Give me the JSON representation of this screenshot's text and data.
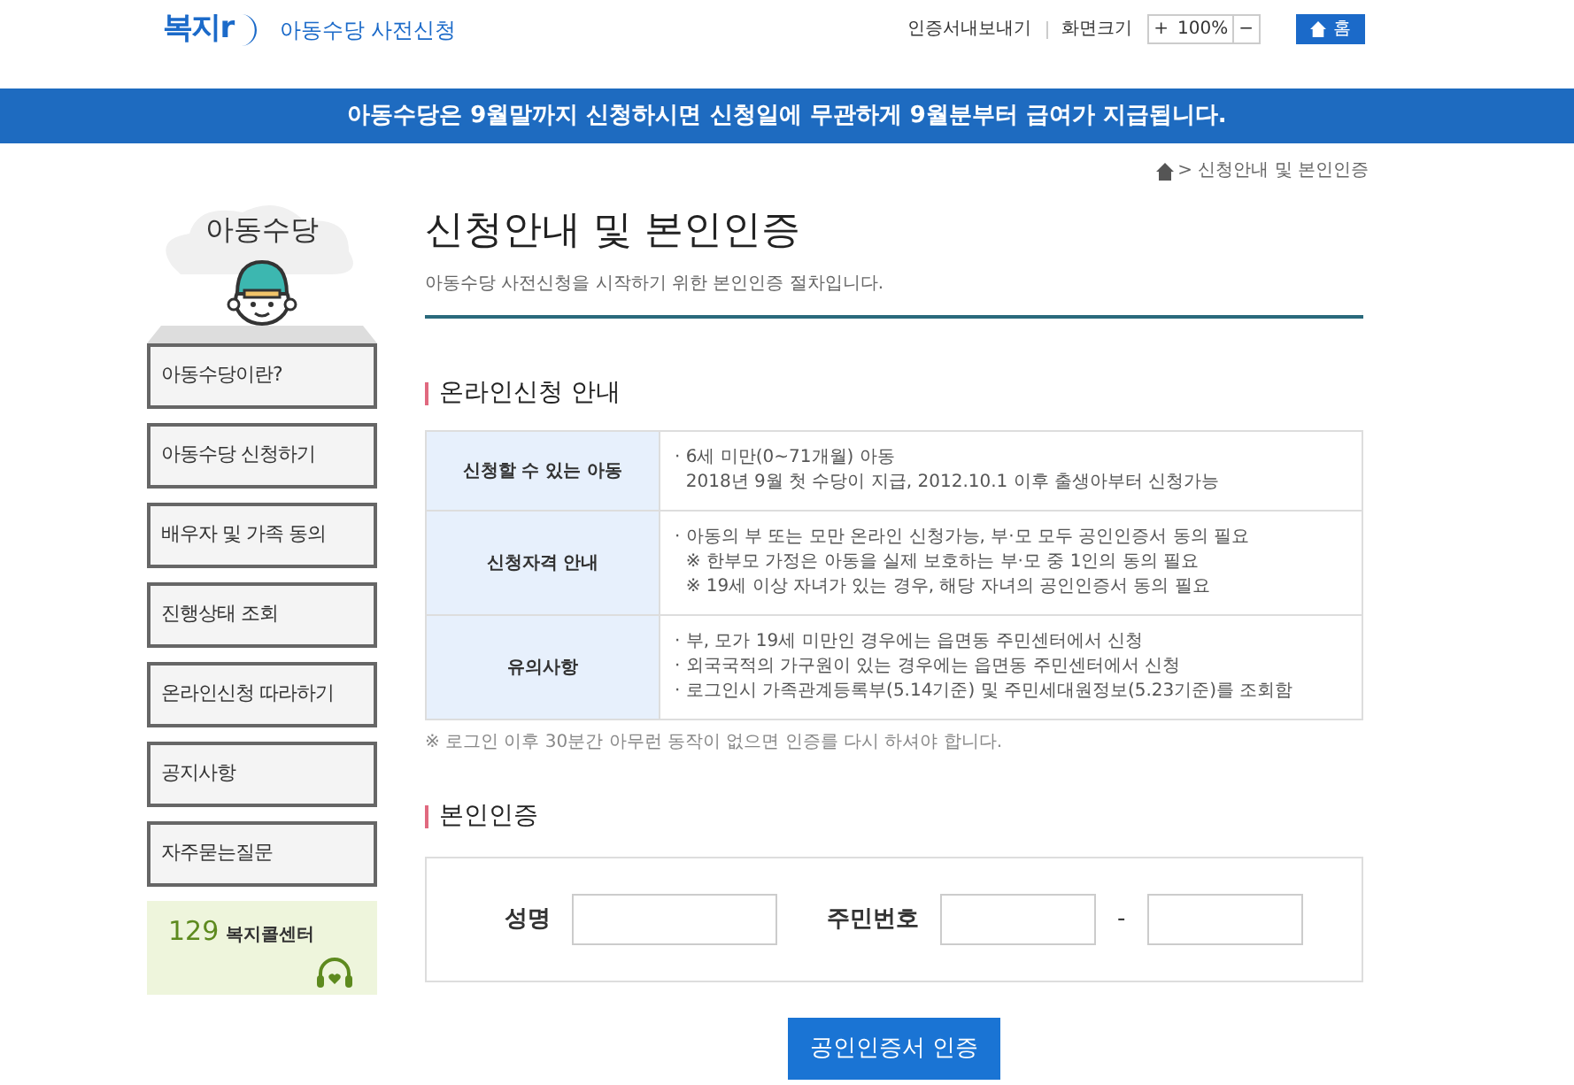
{
  "header": {
    "logo": "복지r",
    "site_title": "아동수당 사전신청",
    "export_link": "인증서내보내기",
    "zoom_label": "화면크기",
    "zoom_in": "+",
    "zoom_value": "100%",
    "zoom_out": "−",
    "home_button": "홈"
  },
  "banner": "아동수당은 9월말까지 신청하시면 신청일에 무관하게 9월분부터 급여가 지급됩니다.",
  "breadcrumb": "> 신청안내 및 본인인증",
  "sidebar": {
    "title": "아동수당",
    "items": [
      {
        "label": "아동수당이란?",
        "selected": false
      },
      {
        "label": "아동수당 신청하기",
        "selected": false
      },
      {
        "label": "배우자 및 가족 동의",
        "selected": false
      },
      {
        "label": "진행상태 조회",
        "selected": false
      },
      {
        "label": "온라인신청 따라하기",
        "selected": false
      },
      {
        "label": "공지사항",
        "selected": false
      },
      {
        "label": "자주묻는질문",
        "selected": false
      }
    ],
    "call_center": {
      "number": "129",
      "label": "복지콜센터"
    }
  },
  "page": {
    "title": "신청안내 및 본인인증",
    "subtitle": "아동수당 사전신청을 시작하기 위한 본인인증 절차입니다."
  },
  "info_section": {
    "heading": "온라인신청 안내",
    "rows": [
      {
        "label": "신청할 수 있는 아동",
        "lines": [
          "· 6세 미만(0~71개월) 아동",
          "  2018년 9월 첫 수당이 지급, 2012.10.1 이후 출생아부터 신청가능"
        ]
      },
      {
        "label": "신청자격 안내",
        "lines": [
          "· 아동의 부 또는 모만 온라인 신청가능, 부·모 모두 공인인증서 동의 필요",
          "  ※ 한부모 가정은 아동을 실제 보호하는 부·모 중 1인의 동의 필요",
          "  ※ 19세 이상 자녀가 있는 경우, 해당 자녀의 공인인증서 동의 필요"
        ]
      },
      {
        "label": "유의사항",
        "lines": [
          "· 부, 모가 19세 미만인 경우에는 읍면동 주민센터에서 신청",
          "· 외국국적의 가구원이 있는 경우에는 읍면동 주민센터에서 신청",
          "· 로그인시 가족관계등록부(5.14기준) 및 주민세대원정보(5.23기준)를 조회함"
        ]
      }
    ],
    "note": "※ 로그인 이후 30분간 아무런 동작이 없으면 인증를 다시 하셔야 합니다."
  },
  "auth_section": {
    "heading": "본인인증",
    "name_label": "성명",
    "id_label": "주민번호",
    "id_separator": "-",
    "submit_button": "공인인증서 인증"
  }
}
